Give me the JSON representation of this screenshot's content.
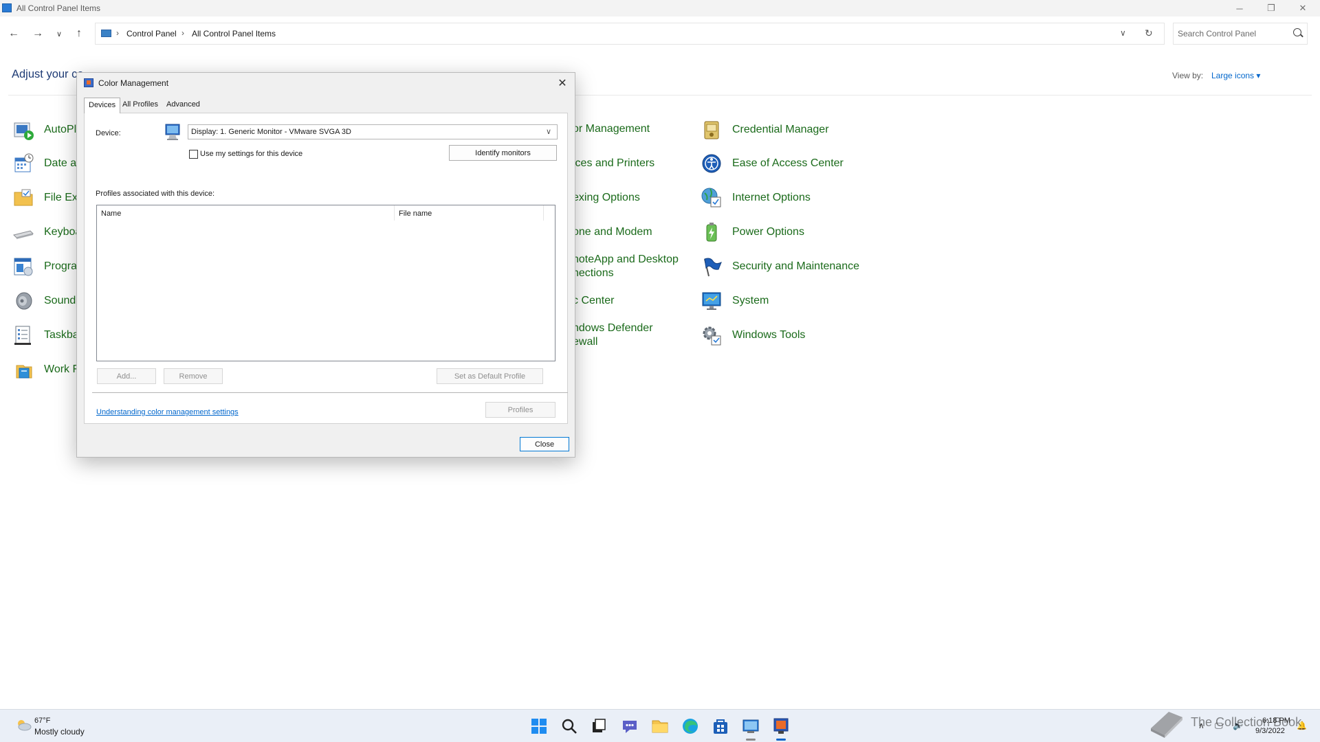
{
  "window": {
    "title": "All Control Panel Items",
    "breadcrumb": [
      "Control Panel",
      "All Control Panel Items"
    ],
    "search_placeholder": "Search Control Panel",
    "heading": "Adjust your co",
    "view_by_label": "View by:",
    "view_by_value": "Large icons ▾"
  },
  "control_panel": {
    "left_column": [
      {
        "label": "AutoPla",
        "icon": "autoplay-icon"
      },
      {
        "label": "Date ar",
        "icon": "calendar-icon"
      },
      {
        "label": "File Exp",
        "icon": "folder-icon"
      },
      {
        "label": "Keyboa",
        "icon": "keyboard-icon"
      },
      {
        "label": "Prograr",
        "icon": "programs-icon"
      },
      {
        "label": "Sound",
        "icon": "speaker-icon"
      },
      {
        "label": "Taskbar",
        "icon": "taskbar-icon"
      },
      {
        "label": "Work F",
        "icon": "work-folders-icon"
      }
    ],
    "middle_column": [
      {
        "label": "or Management"
      },
      {
        "label": "ices and Printers"
      },
      {
        "label": "exing Options"
      },
      {
        "label": "one and Modem"
      },
      {
        "label": "noteApp and Desktop",
        "label2": "nections"
      },
      {
        "label": "c Center"
      },
      {
        "label": "ndows Defender",
        "label2": "ewall"
      }
    ],
    "right_column": [
      {
        "label": "Credential Manager",
        "icon": "credential-manager-icon"
      },
      {
        "label": "Ease of Access Center",
        "icon": "ease-of-access-icon"
      },
      {
        "label": "Internet Options",
        "icon": "internet-options-icon"
      },
      {
        "label": "Power Options",
        "icon": "power-options-icon"
      },
      {
        "label": "Security and Maintenance",
        "icon": "flag-icon"
      },
      {
        "label": "System",
        "icon": "system-icon"
      },
      {
        "label": "Windows Tools",
        "icon": "gear-icon"
      }
    ]
  },
  "dialog": {
    "title": "Color Management",
    "tabs": [
      "Devices",
      "All Profiles",
      "Advanced"
    ],
    "active_tab": "Devices",
    "device_label": "Device:",
    "device_value": "Display: 1. Generic Monitor - VMware SVGA 3D",
    "use_my_settings_label": "Use my settings for this device",
    "use_my_settings_checked": false,
    "identify_button": "Identify monitors",
    "profiles_label": "Profiles associated with this device:",
    "columns": [
      "Name",
      "File name"
    ],
    "add_button": "Add...",
    "remove_button": "Remove",
    "set_default_button": "Set as Default Profile",
    "help_link": "Understanding color management settings",
    "profiles_button": "Profiles",
    "close_button": "Close"
  },
  "taskbar": {
    "weather_temp": "67°F",
    "weather_condition": "Mostly cloudy",
    "clock_time": "6:18 PM",
    "clock_date": "9/3/2022",
    "watermark_text": "The Collection Book",
    "accent": "#0a64c8"
  },
  "colors": {
    "link_green": "#1a6a1a",
    "link_blue": "#0066cc",
    "heading": "#1e3b75"
  }
}
